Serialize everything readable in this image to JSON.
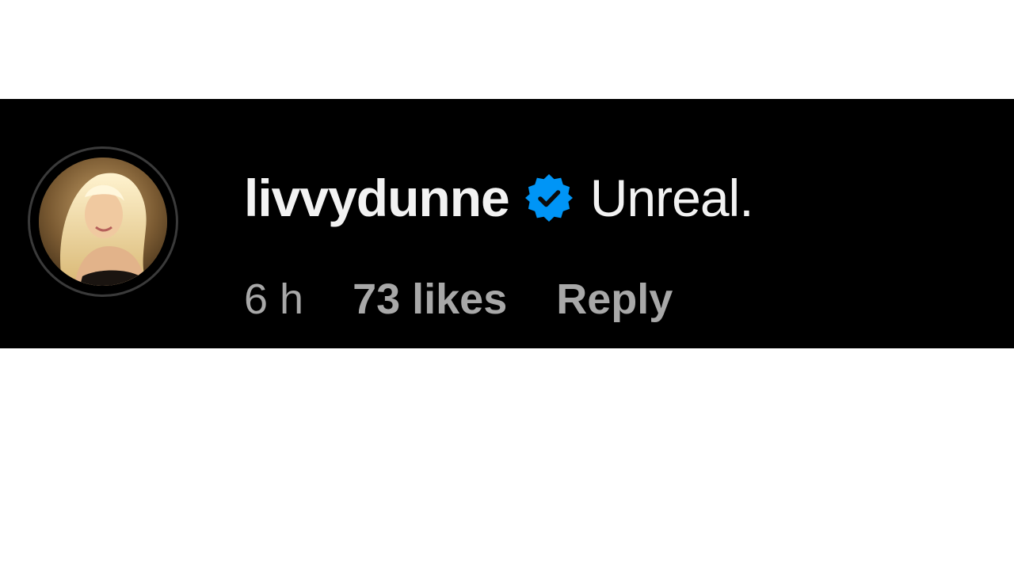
{
  "comment": {
    "username": "livvydunne",
    "verified": true,
    "verified_icon": "verified-badge-icon",
    "text": "Unreal.",
    "time_ago": "6 h",
    "likes": "73 likes",
    "reply_label": "Reply"
  },
  "colors": {
    "background": "#000000",
    "text": "#f2f2f2",
    "meta_text": "#a8a8a8",
    "verified_blue": "#0095f6"
  }
}
